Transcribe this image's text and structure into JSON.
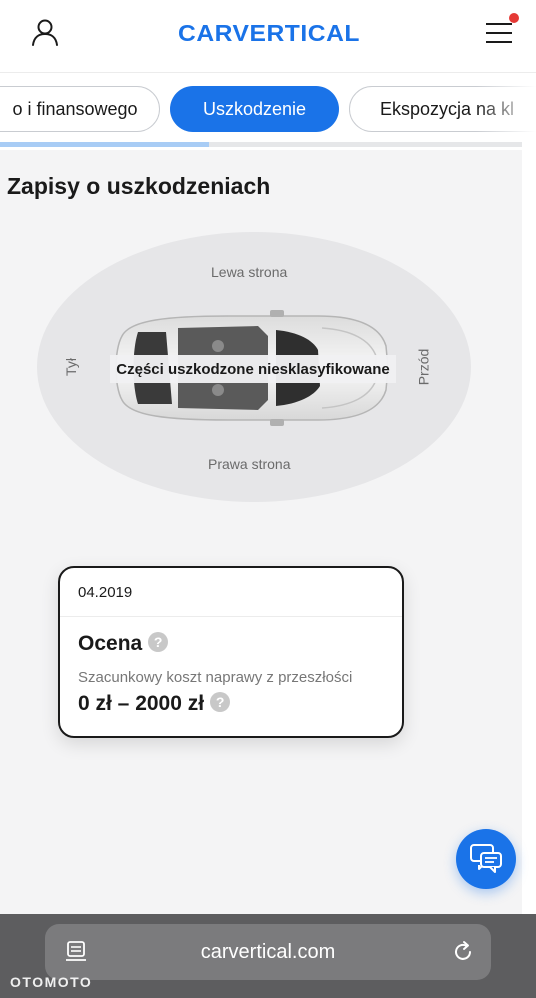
{
  "header": {
    "logo_text": "CARVERTICAL",
    "logo_color": "#1a73e8",
    "user_icon": "user-icon",
    "menu_icon": "hamburger-menu-icon",
    "notification_color": "#e53935"
  },
  "tabs": [
    {
      "label": "o i finansowego",
      "active": false
    },
    {
      "label": "Uszkodzenie",
      "active": true
    },
    {
      "label": "Ekspozycja na kl",
      "active": false
    }
  ],
  "progress": {
    "fraction": 0.4
  },
  "damage": {
    "title": "Zapisy o uszkodzeniach",
    "diagram": {
      "left_label": "Lewa strona",
      "right_label": "Prawa strona",
      "rear_label": "Tył",
      "front_label": "Przód",
      "damage_label": "Części uszkodzone niesklasyfikowane"
    }
  },
  "record": {
    "date": "04.2019",
    "heading": "Ocena",
    "help": "?",
    "subtitle": "Szacunkowy koszt naprawy z przeszłości",
    "cost": "0 zł – 2000 zł"
  },
  "chat": {
    "icon": "chat-icon",
    "color": "#1a73e8"
  },
  "browser": {
    "url": "carvertical.com",
    "reader_icon": "reader-icon",
    "reload_icon": "reload-icon"
  },
  "watermark": "OTOMOTO"
}
